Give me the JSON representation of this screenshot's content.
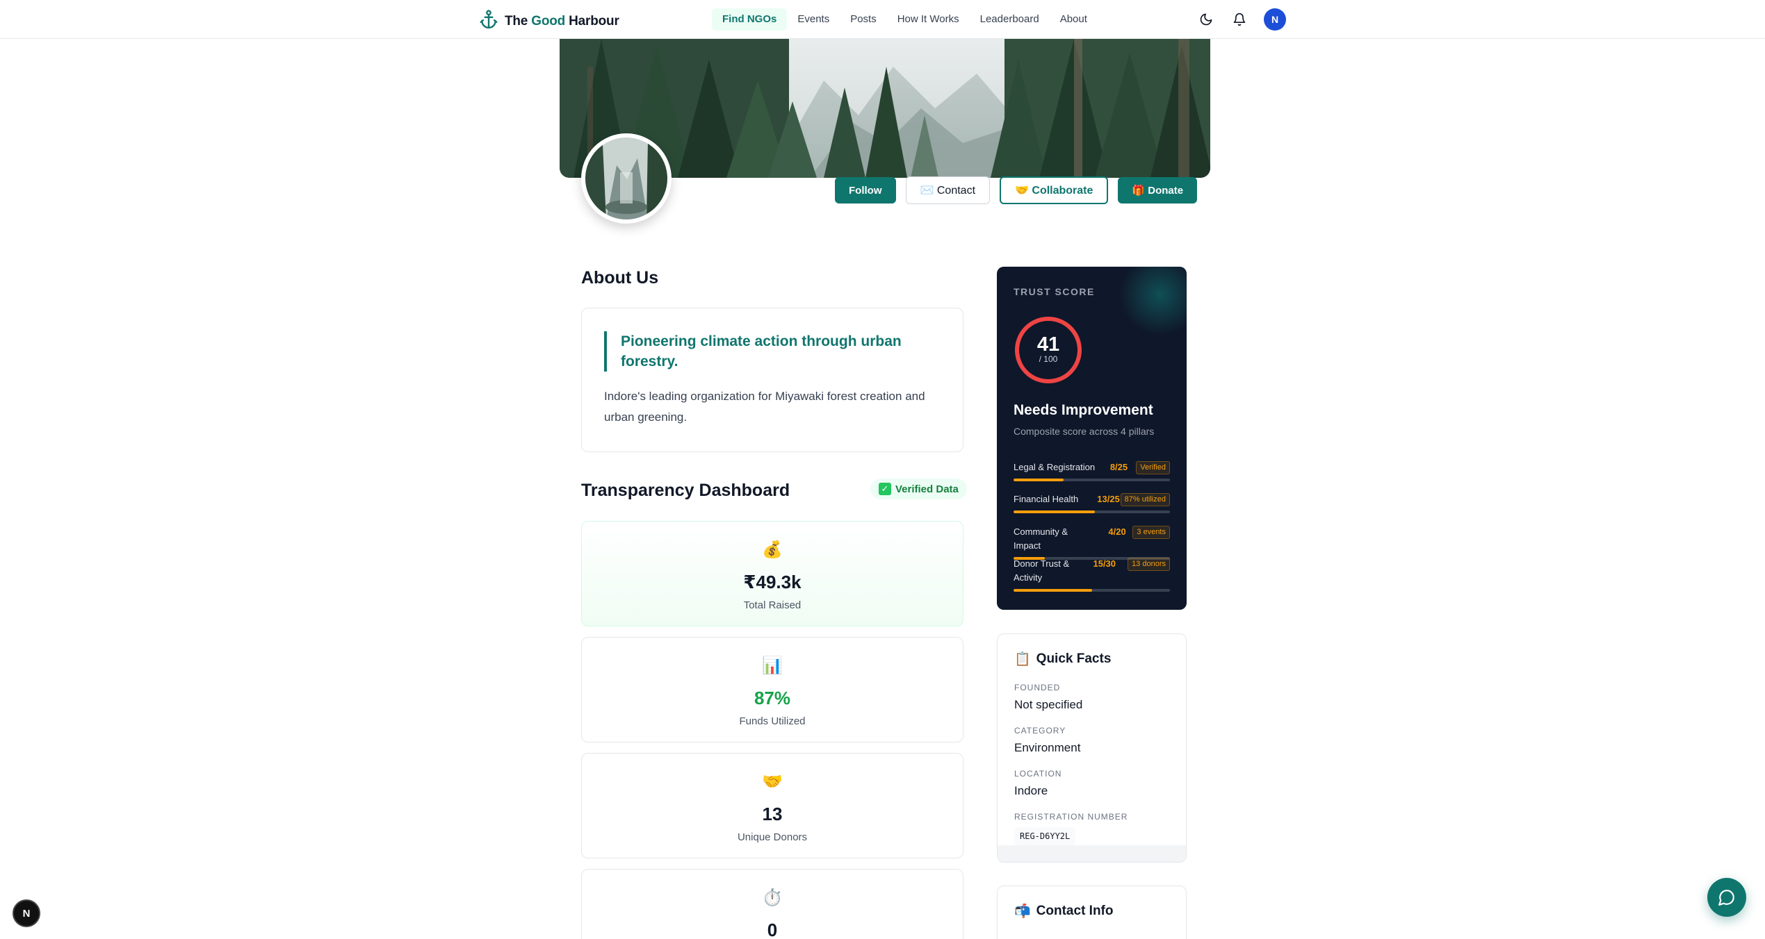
{
  "nav": {
    "brand_prefix": "The ",
    "brand_accent": "Good",
    "brand_suffix": " Harbour",
    "links": [
      "Find NGOs",
      "Events",
      "Posts",
      "How It Works",
      "Leaderboard",
      "About"
    ],
    "active_link": "Find NGOs",
    "avatar_initial": "N"
  },
  "profile": {
    "actions": {
      "follow": "Follow",
      "contact": "✉️ Contact",
      "collaborate": "🤝 Collaborate",
      "donate": "🎁 Donate"
    }
  },
  "about": {
    "title": "About Us",
    "tagline": "Pioneering climate action through urban forestry.",
    "description": "Indore's leading organization for Miyawaki forest creation and urban greening."
  },
  "transparency": {
    "title": "Transparency Dashboard",
    "badge": "Verified Data",
    "stats": [
      {
        "icon": "💰",
        "value": "₹49.3k",
        "label": "Total Raised"
      },
      {
        "icon": "📊",
        "value": "87%",
        "label": "Funds Utilized"
      },
      {
        "icon": "🤝",
        "value": "13",
        "label": "Unique Donors"
      },
      {
        "icon": "⏱️",
        "value": "0",
        "label": ""
      }
    ]
  },
  "trust": {
    "label": "TRUST SCORE",
    "score": "41",
    "score_value": 41,
    "out_of": "/ 100",
    "status": "Needs Improvement",
    "subtitle": "Composite score across 4 pillars",
    "pillars": [
      {
        "name": "Legal & Registration",
        "score": "8/25",
        "badge": "Verified",
        "fraction": 0.32
      },
      {
        "name": "Financial Health",
        "score": "13/25",
        "badge": "87% utilized",
        "fraction": 0.52
      },
      {
        "name": "Community & Impact",
        "score": "4/20",
        "badge": "3 events",
        "fraction": 0.2
      },
      {
        "name": "Donor Trust & Activity",
        "score": "15/30",
        "badge": "13 donors",
        "fraction": 0.5
      }
    ],
    "colors": {
      "ring": "#ef4444",
      "bar": "#f59e0b",
      "background": "#0f172a"
    }
  },
  "facts": {
    "title": "Quick Facts",
    "icon": "📋",
    "founded_label": "FOUNDED",
    "founded_value": "Not specified",
    "category_label": "CATEGORY",
    "category_value": "Environment",
    "location_label": "LOCATION",
    "location_value": "Indore",
    "reg_label": "REGISTRATION NUMBER",
    "reg_value": "REG-D6YY2L"
  },
  "contact_info": {
    "title": "Contact Info",
    "icon": "📬"
  },
  "floating": {
    "left_badge": "N"
  },
  "theme": {
    "primary": "#0f766e",
    "avatar": "#1d4ed8"
  }
}
